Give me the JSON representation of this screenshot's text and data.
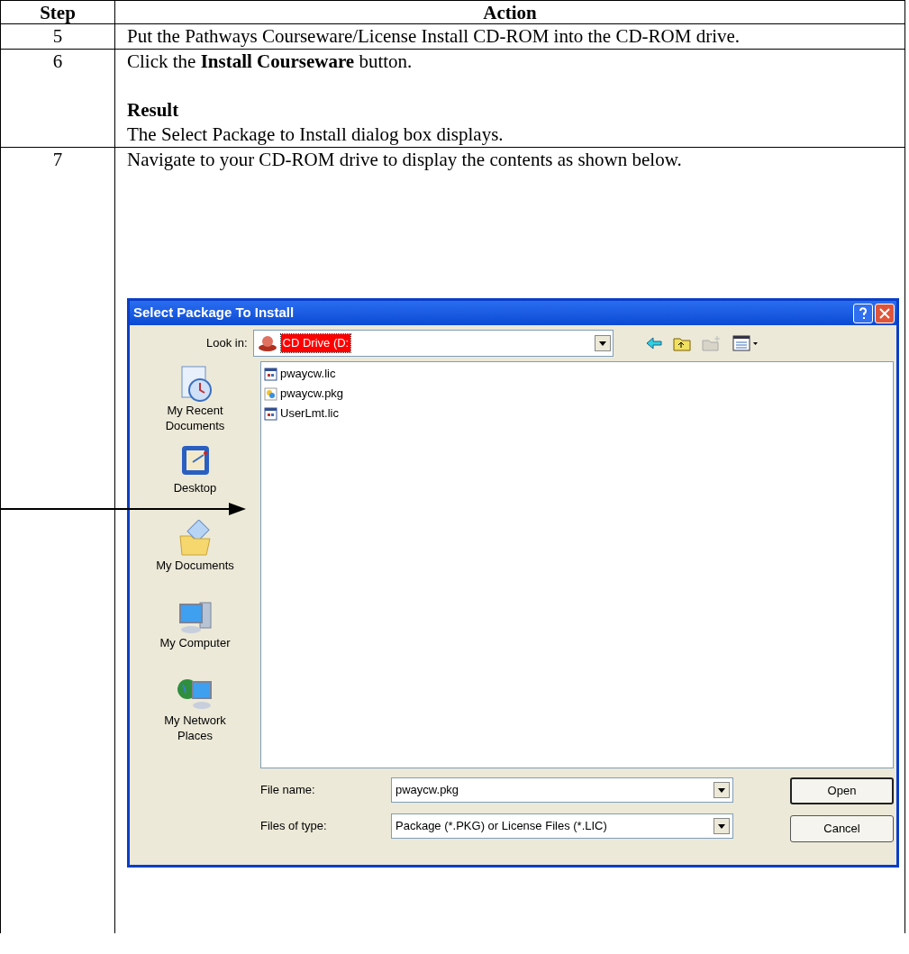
{
  "table": {
    "columns": [
      "Step",
      "Action"
    ],
    "rows": [
      {
        "step": "5",
        "content": [
          {
            "kind": "text",
            "text": "Put the Pathways Courseware/License Install CD-ROM into the CD-ROM drive."
          }
        ]
      },
      {
        "step": "6",
        "content": [
          {
            "kind": "text",
            "text": "Click the **Install Courseware** button."
          },
          {
            "kind": "heading",
            "text": "Result"
          },
          {
            "kind": "text",
            "text": "The Select Package to Install dialog box displays."
          }
        ]
      },
      {
        "step": "7",
        "content": [
          {
            "kind": "text",
            "text": "Navigate to your CD-ROM drive to display the contents as shown below."
          },
          {
            "kind": "dialog"
          }
        ]
      }
    ]
  },
  "dialog": {
    "title": "Select Package To Install",
    "look_in": {
      "label": "Look in:",
      "value": "CD Drive (D:",
      "selected": true
    },
    "places": [
      {
        "kind": "recent",
        "label": "My Recent Documents"
      },
      {
        "kind": "desktop",
        "label": "Desktop"
      },
      {
        "kind": "documents",
        "label": "My Documents"
      },
      {
        "kind": "computer",
        "label": "My Computer"
      },
      {
        "kind": "network",
        "label": "My Network Places"
      }
    ],
    "files": [
      {
        "kind": "lic",
        "name": "pwaycw.lic"
      },
      {
        "kind": "pkg",
        "name": "pwaycw.pkg"
      },
      {
        "kind": "lic",
        "name": "UserLmt.lic"
      }
    ],
    "file_name": {
      "label": "File name:",
      "value": "pwaycw.pkg"
    },
    "file_type": {
      "label": "Files of type:",
      "value": "Package (*.PKG) or License Files (*.LIC)"
    },
    "buttons": [
      "Open",
      "Cancel"
    ]
  }
}
